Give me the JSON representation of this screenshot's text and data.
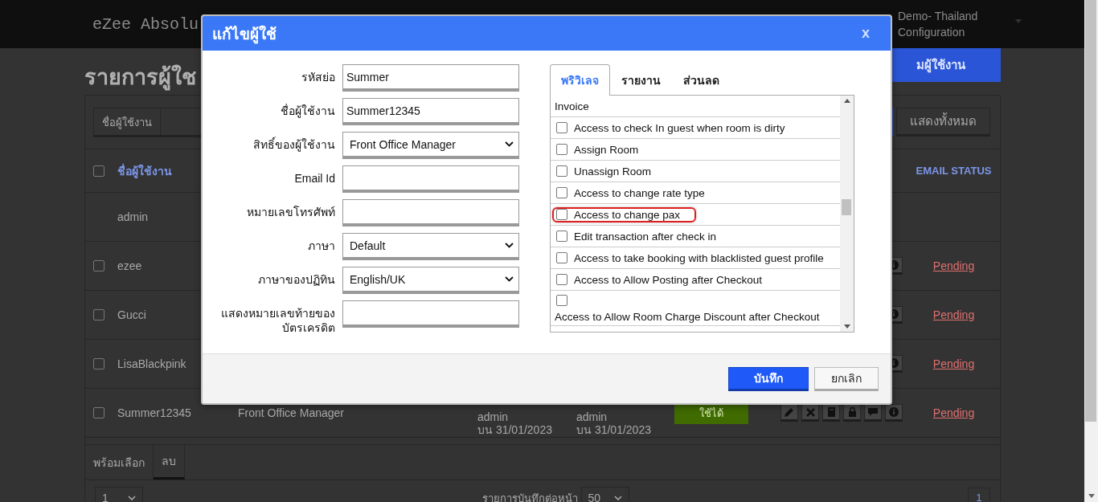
{
  "app": {
    "logo": "eZee Absolu",
    "property": "Demo- Thailand",
    "property_sub": "Configuration"
  },
  "page": {
    "title": "รายการผู้ใช",
    "add_button": "มผู้ใช้งาน"
  },
  "filter": {
    "tab": "ชื่อผู้ใช้งาน",
    "show_all_button": "แสดงทั้งหมด"
  },
  "table": {
    "select_all_checked": false,
    "name_header": "ชื่อผู้ใช้งาน",
    "email_header": "EMAIL STATUS",
    "rows": [
      {
        "name": "admin"
      },
      {
        "name": "ezee",
        "checked": false,
        "actions": [
          {
            "kind": "info"
          }
        ],
        "email_status": "Pending"
      },
      {
        "name": "Gucci",
        "checked": false,
        "actions": [
          {
            "kind": "info"
          }
        ],
        "email_status": "Pending"
      },
      {
        "name": "LisaBlackpink",
        "checked": false,
        "actions": [
          {
            "kind": "info"
          }
        ],
        "email_status": "Pending"
      },
      {
        "name": "Summer12345",
        "checked": false,
        "role": "Front Office Manager",
        "created_by": "admin",
        "created_on": "บน 31/01/2023",
        "modified_by": "admin",
        "modified_on": "บน 31/01/2023",
        "status": "ใช้ได้",
        "actions": [
          {
            "kind": "edit"
          },
          {
            "kind": "delete"
          },
          {
            "kind": "calculator"
          },
          {
            "kind": "lock"
          },
          {
            "kind": "comment"
          },
          {
            "kind": "info"
          }
        ],
        "email_status": "Pending"
      }
    ]
  },
  "bulk_tabs": [
    {
      "label": "พร้อมเลือก",
      "selected": false
    },
    {
      "label": "ลบ",
      "selected": true
    }
  ],
  "pager": {
    "page_select": "1",
    "per_page_label": "รายการบันทึกต่อหน้า",
    "per_page": "50",
    "pages": [
      {
        "label": "1",
        "selected": true
      }
    ]
  },
  "dialog": {
    "title": "แก้ไขผู้ใช้",
    "close": "x",
    "fields": [
      {
        "label": "รหัสย่อ",
        "kind": "text",
        "value": "Summer"
      },
      {
        "label": "ชื่อผู้ใช้งาน",
        "kind": "text",
        "value": "Summer12345"
      },
      {
        "label": "สิทธิ์ของผู้ใช้งาน",
        "kind": "select",
        "value": "Front Office Manager"
      },
      {
        "label": "Email Id",
        "kind": "text"
      },
      {
        "label": "หมายเลขโทรศัพท์",
        "kind": "text"
      },
      {
        "label": "ภาษา",
        "kind": "select",
        "value": "Default"
      },
      {
        "label": "ภาษาของปฏิทิน",
        "kind": "select",
        "value": "English/UK"
      },
      {
        "label": "แสดงหมายเลขท้ายของบัตรเครดิต",
        "kind": "text"
      }
    ],
    "tabs": [
      {
        "label": "พริวิเลจ",
        "selected": true
      },
      {
        "label": "รายงาน",
        "selected": false
      },
      {
        "label": "ส่วนลด",
        "selected": false
      }
    ],
    "privileges": [
      {
        "kind": "continuation",
        "label": "Invoice"
      },
      {
        "kind": "inline",
        "label": "Access to check In guest when room is dirty",
        "checked": false,
        "highlighted": false
      },
      {
        "kind": "inline",
        "label": "Assign Room",
        "checked": false,
        "highlighted": false
      },
      {
        "kind": "inline",
        "label": "Unassign Room",
        "checked": false,
        "highlighted": false
      },
      {
        "kind": "inline",
        "label": "Access to change rate type",
        "checked": false,
        "highlighted": false
      },
      {
        "kind": "inline",
        "label": "Access to change pax",
        "checked": false,
        "highlighted": true
      },
      {
        "kind": "inline",
        "label": "Edit transaction after check in",
        "checked": false,
        "highlighted": false
      },
      {
        "kind": "inline",
        "label": "Access to take booking with blacklisted guest profile",
        "checked": false,
        "highlighted": false
      },
      {
        "kind": "inline",
        "label": "Access to Allow Posting after Checkout",
        "checked": false,
        "highlighted": false
      },
      {
        "kind": "wrapped",
        "label": "Access to Allow Room Charge Discount after Checkout",
        "checked": false,
        "highlighted": false
      }
    ],
    "buttons": [
      {
        "label": "บันทึก",
        "kind": "primary"
      },
      {
        "label": "ยกเลิก",
        "kind": "secondary"
      }
    ]
  }
}
